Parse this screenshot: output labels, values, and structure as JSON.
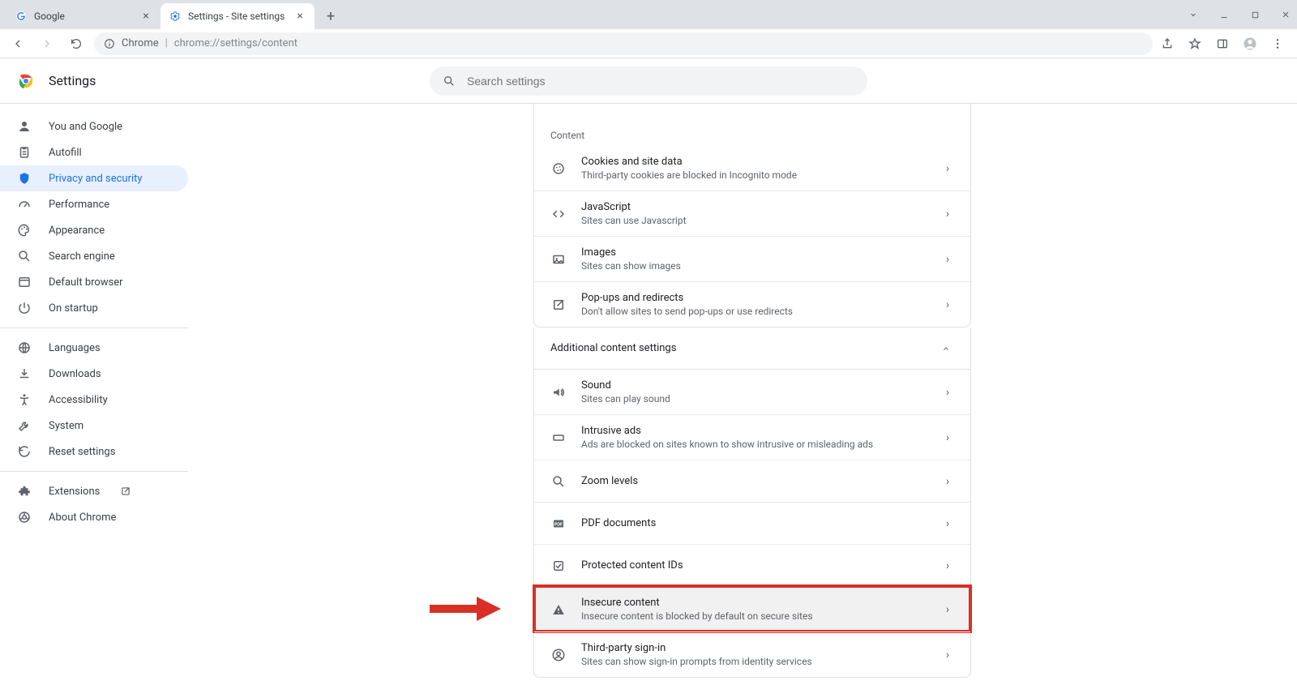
{
  "window": {
    "tabs": [
      {
        "title": "Google",
        "active": false
      },
      {
        "title": "Settings - Site settings",
        "active": true
      }
    ]
  },
  "addressbar": {
    "label": "Chrome",
    "url": "chrome://settings/content"
  },
  "app_header": {
    "title": "Settings",
    "search_placeholder": "Search settings"
  },
  "sidebar": {
    "groups": [
      [
        {
          "id": "you",
          "label": "You and Google",
          "icon": "person"
        },
        {
          "id": "autofill",
          "label": "Autofill",
          "icon": "assignment"
        },
        {
          "id": "privacy",
          "label": "Privacy and security",
          "icon": "shield",
          "active": true
        },
        {
          "id": "performance",
          "label": "Performance",
          "icon": "speed"
        },
        {
          "id": "appearance",
          "label": "Appearance",
          "icon": "palette"
        },
        {
          "id": "search_engine",
          "label": "Search engine",
          "icon": "search"
        },
        {
          "id": "default_browser",
          "label": "Default browser",
          "icon": "browser"
        },
        {
          "id": "on_startup",
          "label": "On startup",
          "icon": "power"
        }
      ],
      [
        {
          "id": "languages",
          "label": "Languages",
          "icon": "globe"
        },
        {
          "id": "downloads",
          "label": "Downloads",
          "icon": "download"
        },
        {
          "id": "accessibility",
          "label": "Accessibility",
          "icon": "accessibility"
        },
        {
          "id": "system",
          "label": "System",
          "icon": "wrench"
        },
        {
          "id": "reset",
          "label": "Reset settings",
          "icon": "restore"
        }
      ],
      [
        {
          "id": "extensions",
          "label": "Extensions",
          "icon": "extension",
          "external": true
        },
        {
          "id": "about",
          "label": "About Chrome",
          "icon": "chrome"
        }
      ]
    ]
  },
  "content_section": {
    "label": "Content",
    "rows": [
      {
        "id": "cookies",
        "icon": "cookie",
        "title": "Cookies and site data",
        "sub": "Third-party cookies are blocked in Incognito mode"
      },
      {
        "id": "javascript",
        "icon": "code",
        "title": "JavaScript",
        "sub": "Sites can use Javascript"
      },
      {
        "id": "images",
        "icon": "image",
        "title": "Images",
        "sub": "Sites can show images"
      },
      {
        "id": "popups",
        "icon": "open_in_new",
        "title": "Pop-ups and redirects",
        "sub": "Don't allow sites to send pop-ups or use redirects"
      }
    ]
  },
  "additional_section": {
    "label": "Additional content settings",
    "expanded": true,
    "rows": [
      {
        "id": "sound",
        "icon": "volume",
        "title": "Sound",
        "sub": "Sites can play sound"
      },
      {
        "id": "ads",
        "icon": "rectangle",
        "title": "Intrusive ads",
        "sub": "Ads are blocked on sites known to show intrusive or misleading ads"
      },
      {
        "id": "zoom",
        "icon": "search",
        "title": "Zoom levels",
        "sub": ""
      },
      {
        "id": "pdf",
        "icon": "pdf",
        "title": "PDF documents",
        "sub": ""
      },
      {
        "id": "protected",
        "icon": "protected",
        "title": "Protected content IDs",
        "sub": ""
      },
      {
        "id": "insecure",
        "icon": "warning",
        "title": "Insecure content",
        "sub": "Insecure content is blocked by default on secure sites",
        "highlight": true
      },
      {
        "id": "third_party_signin",
        "icon": "account_circle",
        "title": "Third-party sign-in",
        "sub": "Sites can show sign-in prompts from identity services"
      }
    ]
  }
}
